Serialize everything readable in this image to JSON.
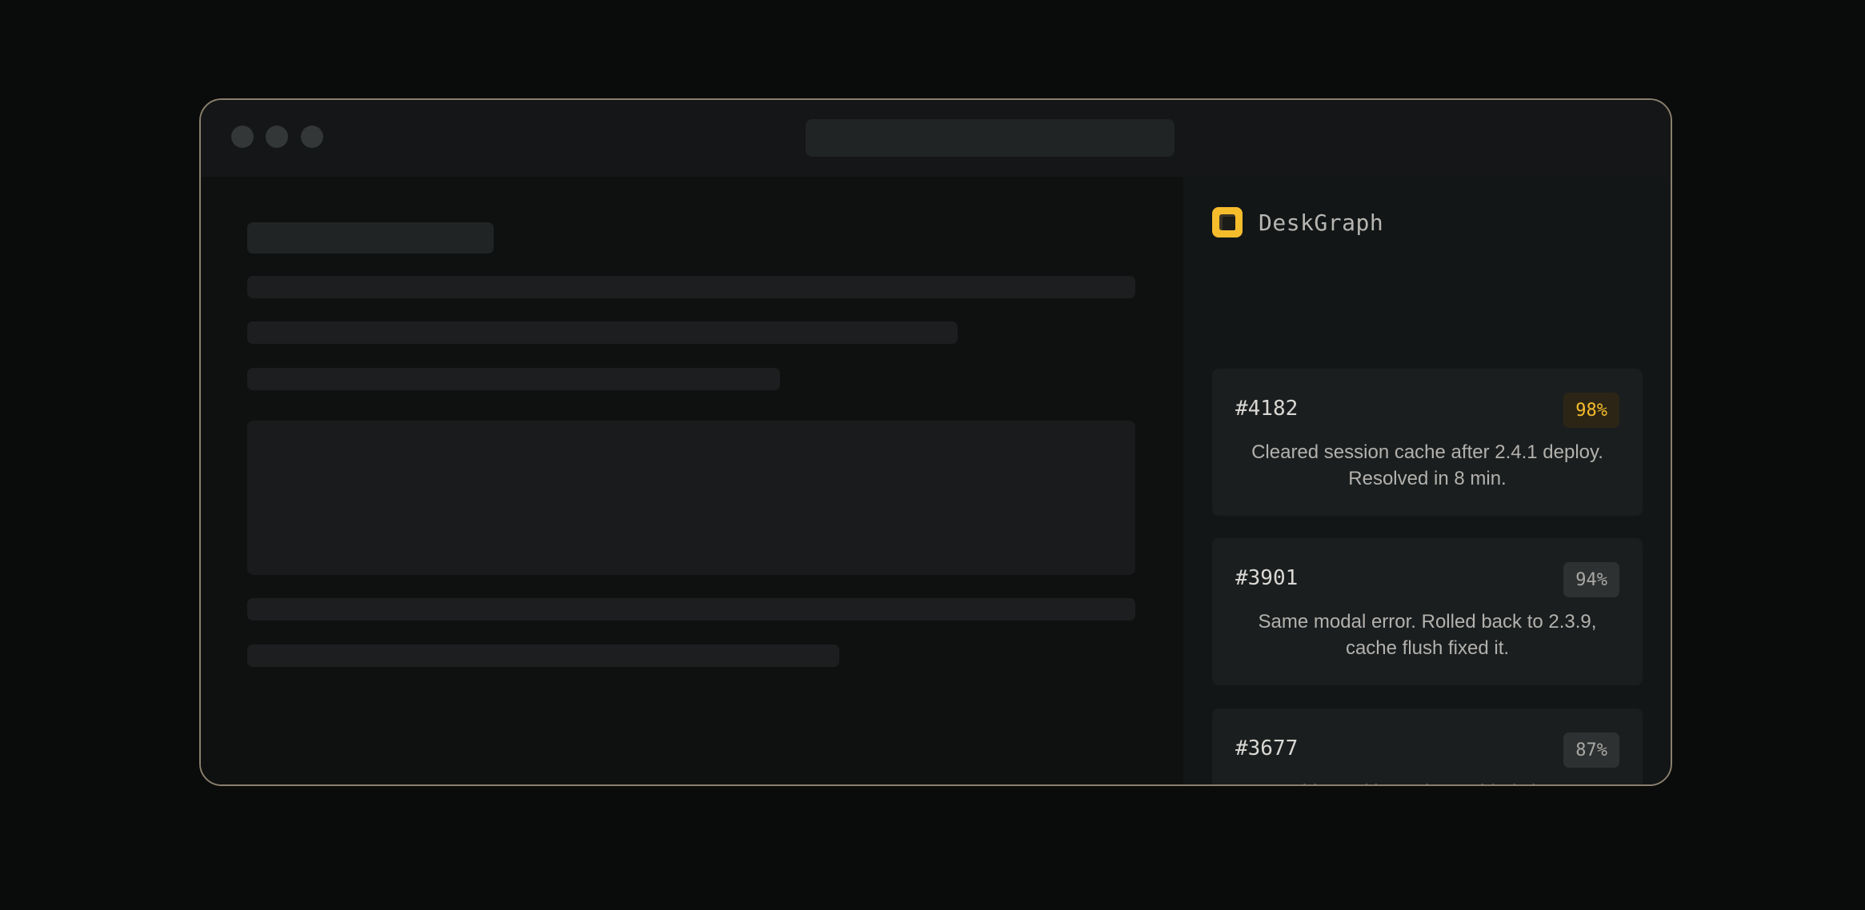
{
  "app": {
    "name": "DeskGraph",
    "logo_icon": "document-stack-icon",
    "accent_color": "#f5bc2c"
  },
  "results": [
    {
      "id": "#4182",
      "match": "98%",
      "text": "Cleared session cache after 2.4.1 deploy. Resolved in 8 min."
    },
    {
      "id": "#3901",
      "match": "94%",
      "text": "Same modal error. Rolled back to 2.3.9, cache flush fixed it."
    },
    {
      "id": "#3677",
      "match": "87%",
      "text": "User-side cookie expiry. Guided clear + re-auth."
    }
  ]
}
